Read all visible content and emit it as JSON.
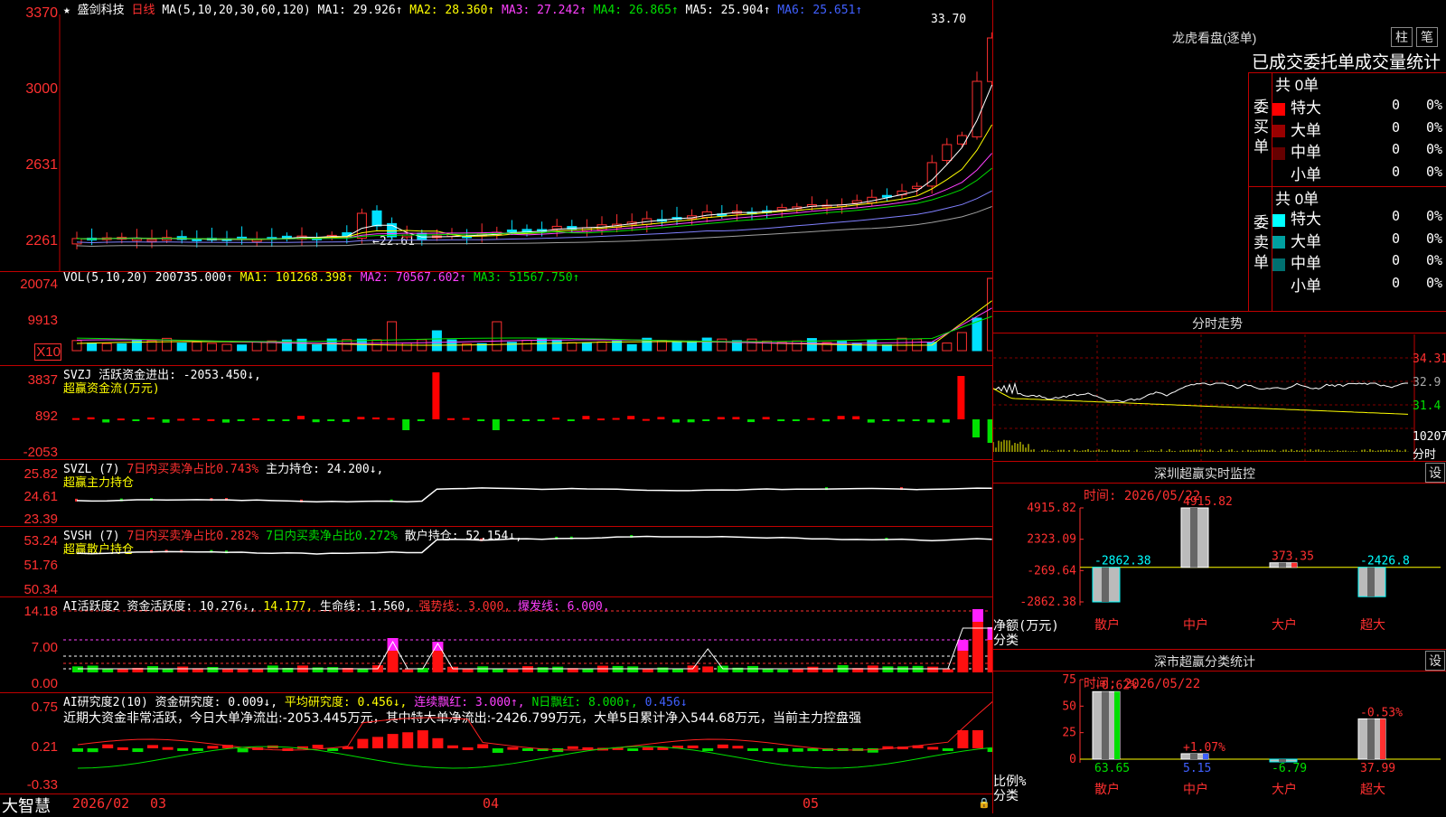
{
  "kline": {
    "header": {
      "star": "★",
      "name": "盛剑科技",
      "period": "日线",
      "ma_label": "MA(5,10,20,30,60,120)",
      "ma1": "MA1: 29.926↑",
      "ma2": "MA2: 28.360↑",
      "ma3": "MA3: 27.242↑",
      "ma4": "MA4: 26.865↑",
      "ma5": "MA5: 25.904↑",
      "ma6": "MA6: 25.651↑"
    },
    "yaxis": [
      "3370",
      "3000",
      "2631",
      "2261"
    ],
    "high_label": "33.70",
    "low_label": "←22.61",
    "colors": {
      "up": "#ff3030",
      "down": "#00e0ff",
      "ma1": "#ffffff",
      "ma2": "#ffff00",
      "ma3": "#ff40ff",
      "ma4": "#00e000",
      "ma5": "#8080ff",
      "ma6": "#a0a0a0"
    }
  },
  "vol": {
    "header": {
      "label": "VOL(5,10,20)",
      "value": "200735.000↑",
      "ma1": "MA1: 101268.398↑",
      "ma2": "MA2: 70567.602↑",
      "ma3": "MA3: 51567.750↑"
    },
    "yaxis": [
      "20074",
      "9913",
      "X10"
    ]
  },
  "svzj": {
    "header": {
      "label": "SVZJ",
      "text": "活跃资金进出: -2053.450↓,",
      "sub": "超赢资金流(万元)"
    },
    "yaxis": [
      "3837",
      "892",
      "-2053"
    ]
  },
  "svzl": {
    "header": {
      "label": "SVZL (7)",
      "t1": "7日内买卖净占比0.743%",
      "t2": "主力持仓: 24.200↓,",
      "sub": "超赢主力持仓"
    },
    "yaxis": [
      "25.82",
      "24.61",
      "23.39"
    ]
  },
  "svsh": {
    "header": {
      "label": "SVSH (7)",
      "t1": "7日内买卖净占比0.282%",
      "t2": "7日内买卖净占比0.272%",
      "t3": "散户持仓: 52.154↓,",
      "sub": "超赢散户持仓"
    },
    "yaxis": [
      "53.24",
      "51.76",
      "50.34"
    ]
  },
  "ai2": {
    "header": {
      "label": "AI活跃度2",
      "t1": "资金活跃度: 10.276↓,",
      "t2": "14.177,",
      "t3": "生命线: 1.560,",
      "t4": "强势线: 3.000,",
      "t5": "爆发线: 6.000,"
    },
    "yaxis": [
      "14.18",
      "7.00",
      "0.00"
    ]
  },
  "ai3": {
    "header": {
      "label": "AI研究度2(10)",
      "t1": "资金研究度: 0.009↓,",
      "t2": "平均研究度: 0.456↓,",
      "t3": "连续飘红: 3.000↑,",
      "t4": "N日飘红: 8.000↑,",
      "t5": "0.456↓"
    },
    "comment": "近期大资金非常活跃，今日大单净流出:-2053.445万元，其中特大单净流出:-2426.799万元，大单5日累计净入544.68万元，当前主力控盘强",
    "yaxis": [
      "0.75",
      "0.21",
      "-0.33"
    ]
  },
  "xaxis": {
    "brand": "大智慧",
    "labels": [
      "2026/02",
      "03",
      "04",
      "05"
    ]
  },
  "longhu": {
    "title": "龙虎看盘(逐单)",
    "btn1": "柱",
    "btn2": "笔",
    "subtitle": "已成交委托单成交量统计",
    "buy": {
      "side": "委买单",
      "total": "共 0单",
      "rows": [
        {
          "name": "特大",
          "count": "0",
          "pct": "0%",
          "color": "#ff0000"
        },
        {
          "name": "大单",
          "count": "0",
          "pct": "0%",
          "color": "#990000"
        },
        {
          "name": "中单",
          "count": "0",
          "pct": "0%",
          "color": "#660000"
        },
        {
          "name": "小单",
          "count": "0",
          "pct": "0%",
          "color": "#000000"
        }
      ]
    },
    "sell": {
      "side": "委卖单",
      "total": "共 0单",
      "rows": [
        {
          "name": "特大",
          "count": "0",
          "pct": "0%",
          "color": "#00ffff"
        },
        {
          "name": "大单",
          "count": "0",
          "pct": "0%",
          "color": "#00a0a0"
        },
        {
          "name": "中单",
          "count": "0",
          "pct": "0%",
          "color": "#007070"
        },
        {
          "name": "小单",
          "count": "0",
          "pct": "0%",
          "color": "#000000"
        }
      ]
    }
  },
  "fenshi": {
    "title": "分时走势",
    "yaxis": [
      "34.31",
      "32.9",
      "31.4",
      "10207"
    ],
    "ylast": "分时"
  },
  "sz_monitor": {
    "title": "深圳超赢实时监控",
    "btn": "设",
    "date": "时间: 2026/05/22",
    "yaxis": [
      "4915.82",
      "2323.09",
      "-269.64",
      "-2862.38"
    ],
    "ylabel1": "净额(万元)",
    "ylabel2": "分类",
    "cats": [
      "散户",
      "中户",
      "大户",
      "超大"
    ]
  },
  "sz_class": {
    "title": "深市超赢分类统计",
    "btn": "设",
    "date": "时间: 2026/05/22",
    "yaxis": [
      "75",
      "50",
      "25",
      "0"
    ],
    "ylabel1": "比例%",
    "ylabel2": "分类",
    "cats": [
      "散户",
      "中户",
      "大户",
      "超大"
    ]
  },
  "chart_data": [
    {
      "type": "bar",
      "title": "深圳超赢实时监控",
      "categories": [
        "散户",
        "中户",
        "大户",
        "超大"
      ],
      "values": [
        -2862.38,
        4915.82,
        373.35,
        -2426.8
      ],
      "ylabel": "净额(万元)",
      "ylim": [
        -2862.38,
        4915.82
      ],
      "labels": [
        "-2862.38",
        "4915.82",
        "373.35",
        "-2426.8"
      ]
    },
    {
      "type": "bar",
      "title": "深市超赢分类统计",
      "categories": [
        "散户",
        "中户",
        "大户",
        "超大"
      ],
      "values": [
        63.65,
        5.15,
        -6.79,
        37.99
      ],
      "changes": [
        "-0.62%",
        "+1.07%",
        "",
        "-0.53%"
      ],
      "ylabel": "比例%",
      "ylim": [
        0,
        75
      ],
      "labels": [
        "63.65",
        "5.15",
        "-6.79",
        "37.99"
      ]
    }
  ]
}
